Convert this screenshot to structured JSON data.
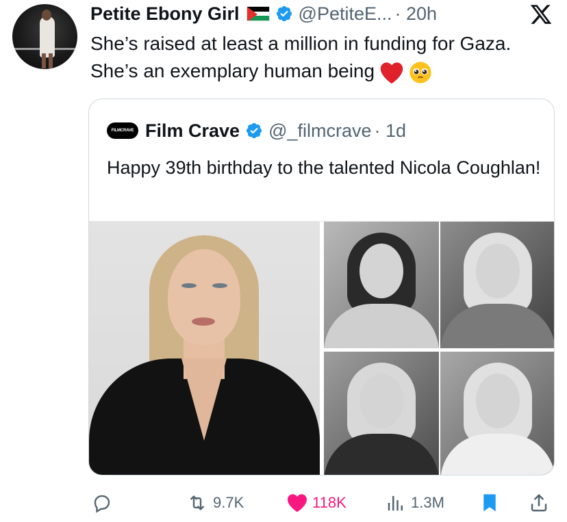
{
  "tweet": {
    "author_name": "Petite Ebony Girl",
    "author_handle": "@PetiteE...",
    "time": "· 20h",
    "text": "She’s raised at least a million in funding for Gaza. She’s an exemplary human being",
    "emojis": [
      "red-heart",
      "pleading-face"
    ]
  },
  "quoted": {
    "logo_text": "FILMCRAVE",
    "author_name": "Film Crave",
    "author_handle": "@_filmcrave",
    "time": "· 1d",
    "text": "Happy 39th birthday to the talented Nicola Coughlan!"
  },
  "actions": {
    "replies": "",
    "retweets": "9.7K",
    "likes": "118K",
    "views": "1.3M"
  },
  "colors": {
    "accent": "#1d9bf0",
    "like": "#f91880",
    "muted": "#536471",
    "border": "#cfd9de"
  }
}
